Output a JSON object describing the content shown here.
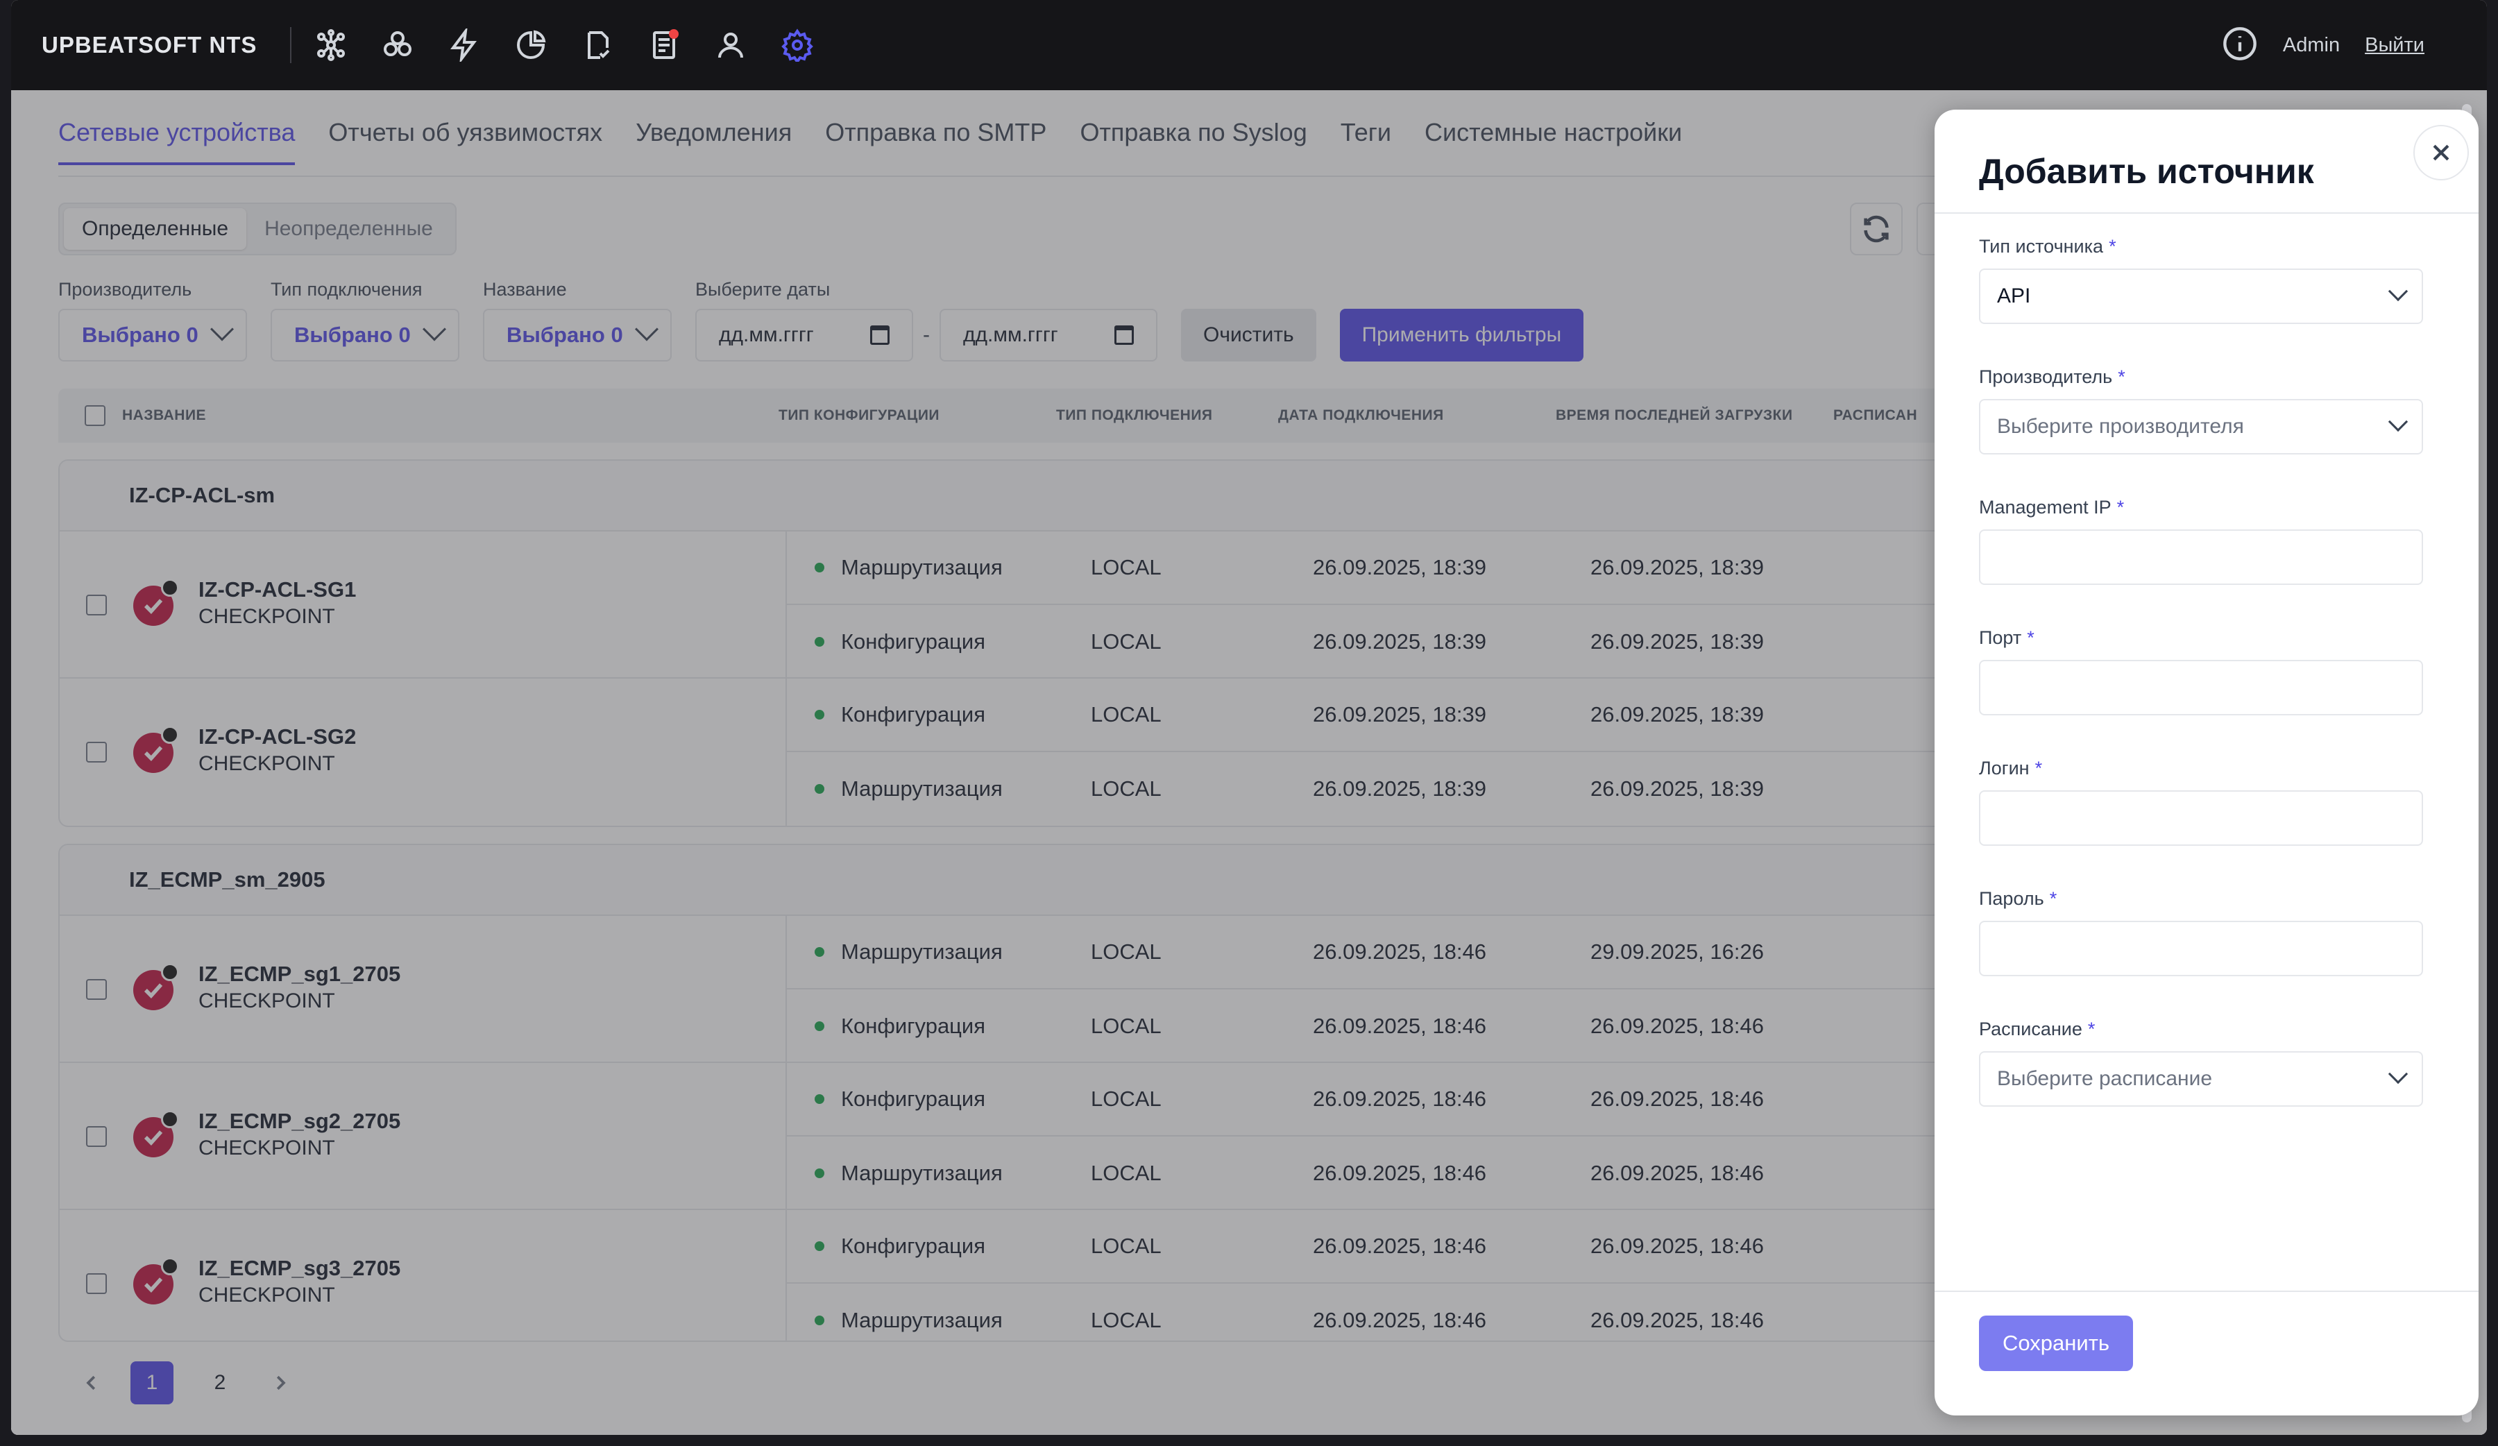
{
  "app": {
    "brand": "UPBEATSOFT NTS",
    "nav_icons": [
      "network-icon",
      "hexagons-icon",
      "lightning-icon",
      "pie-chart-icon",
      "document-check-icon",
      "report-icon",
      "user-icon",
      "settings-icon"
    ],
    "user": "Admin",
    "logout": "Выйти"
  },
  "tabs": [
    {
      "label": "Сетевые устройства",
      "active": true
    },
    {
      "label": "Отчеты об уязвимостях"
    },
    {
      "label": "Уведомления"
    },
    {
      "label": "Отправка по SMTP"
    },
    {
      "label": "Отправка по Syslog"
    },
    {
      "label": "Теги"
    },
    {
      "label": "Системные настройки"
    }
  ],
  "segment": {
    "defined": "Определенные",
    "undefined": "Неопределенные"
  },
  "filters": {
    "vendor": {
      "label": "Производитель",
      "value": "Выбрано 0"
    },
    "connection": {
      "label": "Тип подключения",
      "value": "Выбрано 0"
    },
    "name": {
      "label": "Название",
      "value": "Выбрано 0"
    },
    "dates": {
      "label": "Выберите даты",
      "from": "дд.мм.гггг",
      "to": "дд.мм.гггг",
      "separator": "-"
    },
    "clear": "Очистить",
    "apply": "Применить фильтры"
  },
  "table": {
    "headers": [
      "НАЗВАНИЕ",
      "ТИП КОНФИГУРАЦИИ",
      "ТИП ПОДКЛЮЧЕНИЯ",
      "ДАТА ПОДКЛЮЧЕНИЯ",
      "ВРЕМЯ ПОСЛЕДНЕЙ ЗАГРУЗКИ",
      "РАСПИСАН"
    ],
    "groups": [
      {
        "name": "IZ-CP-ACL-sm",
        "devices": [
          {
            "name": "IZ-CP-ACL-SG1",
            "vendor": "CHECKPOINT",
            "rows": [
              {
                "config": "Маршрутизация",
                "conn": "LOCAL",
                "date": "26.09.2025, 18:39",
                "last": "26.09.2025, 18:39"
              },
              {
                "config": "Конфигурация",
                "conn": "LOCAL",
                "date": "26.09.2025, 18:39",
                "last": "26.09.2025, 18:39"
              }
            ]
          },
          {
            "name": "IZ-CP-ACL-SG2",
            "vendor": "CHECKPOINT",
            "rows": [
              {
                "config": "Конфигурация",
                "conn": "LOCAL",
                "date": "26.09.2025, 18:39",
                "last": "26.09.2025, 18:39"
              },
              {
                "config": "Маршрутизация",
                "conn": "LOCAL",
                "date": "26.09.2025, 18:39",
                "last": "26.09.2025, 18:39"
              }
            ]
          }
        ]
      },
      {
        "name": "IZ_ECMP_sm_2905",
        "devices": [
          {
            "name": "IZ_ECMP_sg1_2705",
            "vendor": "CHECKPOINT",
            "rows": [
              {
                "config": "Маршрутизация",
                "conn": "LOCAL",
                "date": "26.09.2025, 18:46",
                "last": "29.09.2025, 16:26"
              },
              {
                "config": "Конфигурация",
                "conn": "LOCAL",
                "date": "26.09.2025, 18:46",
                "last": "26.09.2025, 18:46"
              }
            ]
          },
          {
            "name": "IZ_ECMP_sg2_2705",
            "vendor": "CHECKPOINT",
            "rows": [
              {
                "config": "Конфигурация",
                "conn": "LOCAL",
                "date": "26.09.2025, 18:46",
                "last": "26.09.2025, 18:46"
              },
              {
                "config": "Маршрутизация",
                "conn": "LOCAL",
                "date": "26.09.2025, 18:46",
                "last": "26.09.2025, 18:46"
              }
            ]
          },
          {
            "name": "IZ_ECMP_sg3_2705",
            "vendor": "CHECKPOINT",
            "rows": [
              {
                "config": "Конфигурация",
                "conn": "LOCAL",
                "date": "26.09.2025, 18:46",
                "last": "26.09.2025, 18:46"
              },
              {
                "config": "Маршрутизация",
                "conn": "LOCAL",
                "date": "26.09.2025, 18:46",
                "last": "26.09.2025, 18:46"
              }
            ]
          }
        ]
      }
    ]
  },
  "pagination": {
    "pages": [
      "1",
      "2"
    ],
    "current": "1"
  },
  "drawer": {
    "title": "Добавить источник",
    "required_mark": "*",
    "fields": {
      "source_type": {
        "label": "Тип источника",
        "value": "API"
      },
      "vendor": {
        "label": "Производитель",
        "placeholder": "Выберите производителя"
      },
      "mgmt_ip": {
        "label": "Management IP",
        "value": ""
      },
      "port": {
        "label": "Порт",
        "value": ""
      },
      "login": {
        "label": "Логин",
        "value": ""
      },
      "password": {
        "label": "Пароль",
        "value": ""
      },
      "schedule": {
        "label": "Расписание",
        "placeholder": "Выберите расписание"
      }
    },
    "save": "Сохранить"
  },
  "colors": {
    "accent": "#4f46e5",
    "topbar": "#151518",
    "status_ok": "#16a34a",
    "vendor_icon": "#be123c"
  }
}
